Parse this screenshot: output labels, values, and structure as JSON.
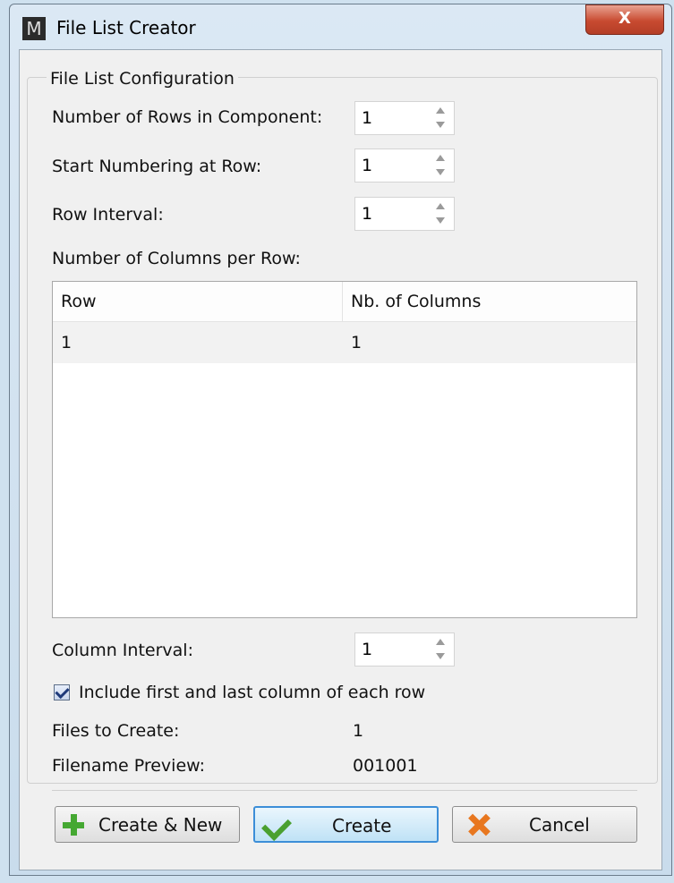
{
  "window": {
    "title": "File List Creator",
    "app_icon_letter": "M",
    "close_glyph": "X"
  },
  "group": {
    "legend": "File List Configuration"
  },
  "fields": {
    "rows_in_component": {
      "label": "Number of Rows in Component:",
      "value": "1"
    },
    "start_numbering": {
      "label": "Start Numbering at Row:",
      "value": "1"
    },
    "row_interval": {
      "label": "Row Interval:",
      "value": "1"
    },
    "columns_per_row_label": "Number of Columns per Row:",
    "column_interval": {
      "label": "Column Interval:",
      "value": "1"
    }
  },
  "table": {
    "headers": [
      "Row",
      "Nb. of Columns"
    ],
    "rows": [
      [
        "1",
        "1"
      ]
    ]
  },
  "include_first_last": {
    "label": "Include first and last column of each row",
    "checked": true
  },
  "info": {
    "files_to_create_label": "Files to Create:",
    "files_to_create_value": "1",
    "filename_preview_label": "Filename Preview:",
    "filename_preview_value": "001001"
  },
  "buttons": {
    "create_new": "Create & New",
    "create": "Create",
    "cancel": "Cancel"
  },
  "icons": {
    "app": "app-logo-icon",
    "close": "close-icon",
    "create_new": "plus-icon",
    "create": "checkmark-icon",
    "cancel": "x-icon"
  },
  "colors": {
    "close_button": "#c84a30",
    "primary_button_border": "#3c8ed8",
    "plus_green": "#45a832",
    "cancel_orange": "#e8771f"
  }
}
